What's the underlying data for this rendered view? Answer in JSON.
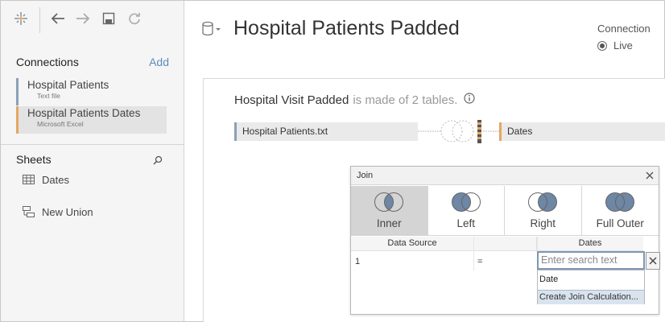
{
  "connections": {
    "heading": "Connections",
    "add_label": "Add",
    "items": [
      {
        "name": "Hospital Patients",
        "type": "Text file",
        "color": "#8aa0b8"
      },
      {
        "name": "Hospital Patients Dates",
        "type": "Microsoft Excel",
        "color": "#e3a765"
      }
    ]
  },
  "sheets": {
    "heading": "Sheets",
    "items": [
      {
        "label": "Dates",
        "icon": "table-icon"
      },
      {
        "label": "New Union",
        "icon": "union-icon"
      }
    ]
  },
  "toolbar": {
    "icons": [
      "tableau-logo-icon",
      "back-arrow-icon",
      "forward-arrow-icon",
      "save-icon",
      "refresh-icon"
    ]
  },
  "header": {
    "title": "Hospital Patients Padded",
    "connection_label": "Connection",
    "connection_mode": "Live"
  },
  "canvas": {
    "data_source_name": "Hospital Visit Padded",
    "made_of_text": "is made of 2 tables.",
    "tables": [
      "Hospital Patients.txt",
      "Dates"
    ]
  },
  "join_dialog": {
    "title": "Join",
    "join_types": [
      {
        "label": "Inner",
        "active": true
      },
      {
        "label": "Left",
        "active": false
      },
      {
        "label": "Right",
        "active": false
      },
      {
        "label": "Full Outer",
        "active": false
      }
    ],
    "columns": {
      "left": "Data Source",
      "right": "Dates"
    },
    "clause": {
      "left_value": "1",
      "operator": "="
    },
    "search_placeholder": "Enter search text",
    "dropdown": {
      "items": [
        "Date"
      ],
      "create_calc": "Create Join Calculation..."
    }
  },
  "colors": {
    "primary_accent": "#8aa0b8",
    "secondary_accent": "#e3a765",
    "venn_fill": "#6d87a4"
  }
}
